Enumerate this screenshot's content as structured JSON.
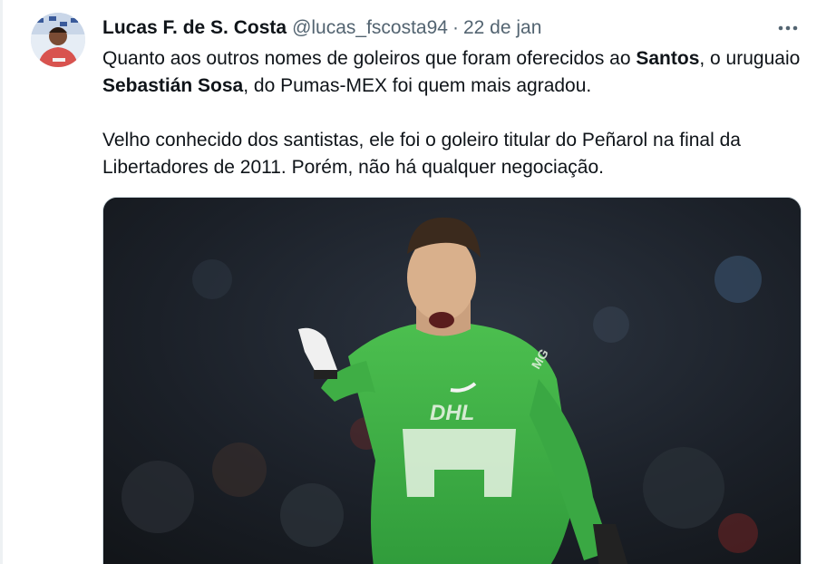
{
  "tweet": {
    "author": {
      "display_name": "Lucas F. de S. Costa",
      "handle": "@lucas_fscosta94"
    },
    "separator": "·",
    "date": "22 de jan",
    "more_icon": "more-horizontal-icon",
    "paragraph1": {
      "t1": "Quanto aos outros nomes de goleiros que foram oferecidos ao ",
      "b1": "Santos",
      "t2": ", o uruguaio ",
      "b2": "Sebastián Sosa",
      "t3": ", do Pumas-MEX foi quem mais agradou."
    },
    "paragraph2": "Velho conhecido dos santistas, ele foi o goleiro titular do Peñarol na final da Libertadores de 2011. Porém, não há qualquer negociação.",
    "jersey_sponsor": "DHL",
    "jersey_sleeve_text": "MG"
  },
  "colors": {
    "text": "#0f1419",
    "secondary": "#536471",
    "jersey_green": "#3fae45"
  }
}
